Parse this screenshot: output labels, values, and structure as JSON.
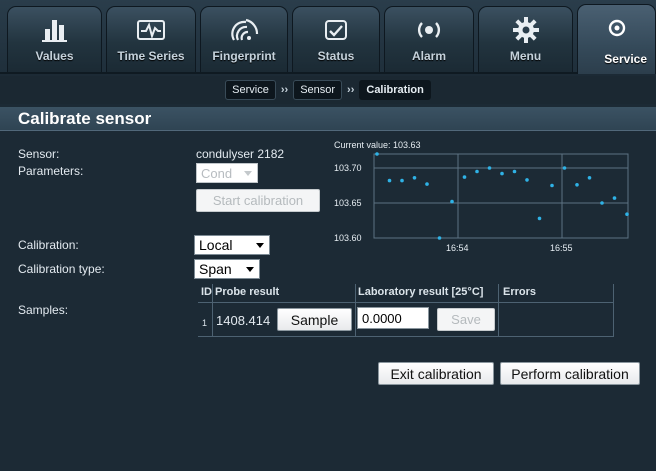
{
  "tabs": [
    {
      "label": "Values",
      "icon": "bar-chart-icon"
    },
    {
      "label": "Time Series",
      "icon": "waveform-icon"
    },
    {
      "label": "Fingerprint",
      "icon": "fingerprint-icon"
    },
    {
      "label": "Status",
      "icon": "status-icon"
    },
    {
      "label": "Alarm",
      "icon": "alarm-icon"
    },
    {
      "label": "Menu",
      "icon": "gear-icon"
    },
    {
      "label": "Service",
      "icon": "service-icon",
      "active": true
    }
  ],
  "breadcrumb": {
    "items": [
      "Service",
      "Sensor",
      "Calibration"
    ],
    "separator": "››"
  },
  "section": {
    "title": "Calibrate sensor"
  },
  "form": {
    "sensor_label": "Sensor:",
    "sensor_value": "condulyser 2182",
    "parameters_label": "Parameters:",
    "parameter_select": "Cond",
    "start_calibration_button": "Start calibration",
    "calibration_label": "Calibration:",
    "calibration_select": "Local",
    "calibration_type_label": "Calibration type:",
    "calibration_type_select": "Span",
    "samples_label": "Samples:"
  },
  "samples_table": {
    "headers": [
      "ID",
      "Probe result",
      "Laboratory result [25°C]",
      "Errors"
    ],
    "rows": [
      {
        "id": "1",
        "probe_result": "1408.414",
        "sample_button": "Sample",
        "lab_result": "0.0000",
        "save_button": "Save",
        "errors": ""
      }
    ]
  },
  "actions": {
    "exit_calibration": "Exit calibration",
    "perform_calibration": "Perform calibration"
  },
  "colors": {
    "background": "#1c2a35",
    "header": "#2f4453",
    "point": "#2fb2e6"
  },
  "chart_data": {
    "type": "scatter",
    "title": "Current value: 103.63",
    "y_ticks": [
      "103.70",
      "103.65",
      "103.60"
    ],
    "x_ticks": [
      "16:54",
      "16:55"
    ],
    "ylim": [
      103.6,
      103.72
    ],
    "grid": true,
    "y": [
      103.72,
      103.682,
      103.682,
      103.686,
      103.677,
      103.6,
      103.652,
      103.687,
      103.695,
      103.7,
      103.692,
      103.695,
      103.683,
      103.628,
      103.675,
      103.7,
      103.676,
      103.686,
      103.65,
      103.657,
      103.634
    ]
  }
}
